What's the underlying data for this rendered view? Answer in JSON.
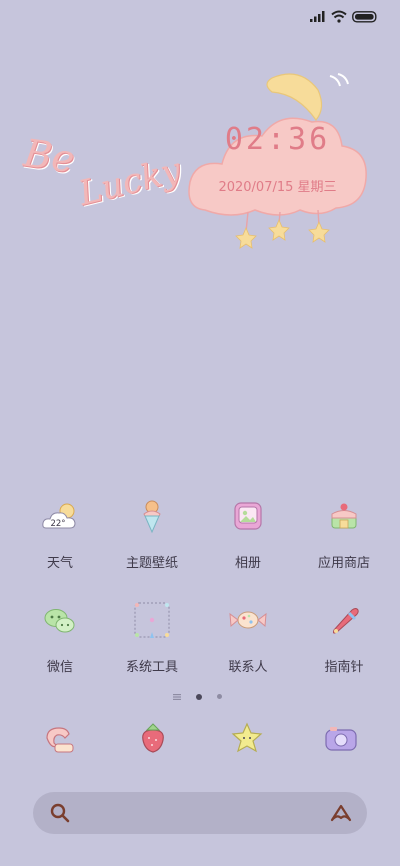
{
  "status_bar": {
    "icons": [
      "signal-icon",
      "wifi-icon",
      "battery-icon"
    ]
  },
  "widget": {
    "be_text": "Be",
    "lucky_text": "Lucky",
    "time": "02:36",
    "date": "2020/07/15 星期三"
  },
  "apps": [
    {
      "label": "天气",
      "icon": "weather-icon",
      "temp": "22°"
    },
    {
      "label": "主题壁纸",
      "icon": "ice-cream-icon"
    },
    {
      "label": "相册",
      "icon": "photo-album-icon"
    },
    {
      "label": "应用商店",
      "icon": "cake-store-icon"
    },
    {
      "label": "微信",
      "icon": "wechat-icon"
    },
    {
      "label": "系统工具",
      "icon": "system-tools-icon"
    },
    {
      "label": "联系人",
      "icon": "candy-contacts-icon"
    },
    {
      "label": "指南针",
      "icon": "compass-icon"
    }
  ],
  "page_indicator": {
    "pages": 2,
    "active": 1
  },
  "dock": [
    "phone-icon",
    "strawberry-icon",
    "star-icon",
    "camera-icon"
  ],
  "search": {
    "placeholder": ""
  },
  "colors": {
    "background": "#c6c5dc",
    "accent_pink": "#e07c88",
    "cloud": "#f7c9c6",
    "moon": "#f7dc9a"
  }
}
